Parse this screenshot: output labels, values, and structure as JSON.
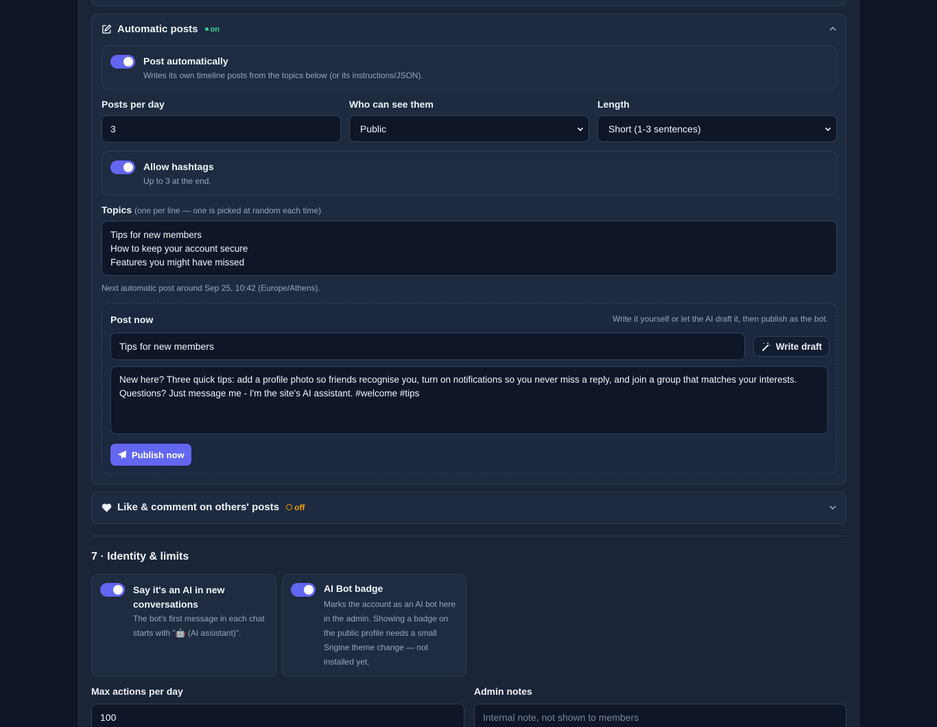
{
  "automatic_posts": {
    "title": "Automatic posts",
    "status": "on",
    "post_auto": {
      "title": "Post automatically",
      "desc": "Writes its own timeline posts from the topics below (or its instructions/JSON)."
    },
    "posts_per_day": {
      "label": "Posts per day",
      "value": "3"
    },
    "visibility": {
      "label": "Who can see them",
      "value": "Public"
    },
    "length": {
      "label": "Length",
      "value": "Short (1-3 sentences)"
    },
    "hashtags": {
      "title": "Allow hashtags",
      "desc": "Up to 3 at the end."
    },
    "topics": {
      "label": "Topics",
      "hint": "(one per line — one is picked at random each time)",
      "value": "Tips for new members\nHow to keep your account secure\nFeatures you might have missed"
    },
    "next_post": "Next automatic post around Sep 25, 10:42 (Europe/Athens).",
    "post_now": {
      "title": "Post now",
      "hint": "Write it yourself or let the AI draft it, then publish as the bot.",
      "topic_value": "Tips for new members",
      "write_draft_label": "Write draft",
      "body": "New here? Three quick tips: add a profile photo so friends recognise you, turn on notifications so you never miss a reply, and join a group that matches your interests. Questions? Just message me - I'm the site's AI assistant. #welcome #tips",
      "publish_label": "Publish now"
    }
  },
  "like_comment": {
    "title": "Like & comment on others' posts",
    "status": "off"
  },
  "identity": {
    "heading": "7 · Identity & limits",
    "say_ai": {
      "title": "Say it's an AI in new conversations",
      "desc": "The bot's first message in each chat starts with \"🤖 (AI assistant)\"."
    },
    "badge": {
      "title": "AI Bot badge",
      "desc": "Marks the account as an AI bot here in the admin. Showing a badge on the public profile needs a small Sngine theme change — not installed yet."
    },
    "max_actions": {
      "label": "Max actions per day",
      "value": "100"
    },
    "admin_notes": {
      "label": "Admin notes",
      "placeholder": "Internal note, not shown to members"
    }
  },
  "colors": {
    "accent": "#6366f1",
    "on": "#34d399",
    "off": "#f59e0b",
    "bg": "#0f1628"
  }
}
